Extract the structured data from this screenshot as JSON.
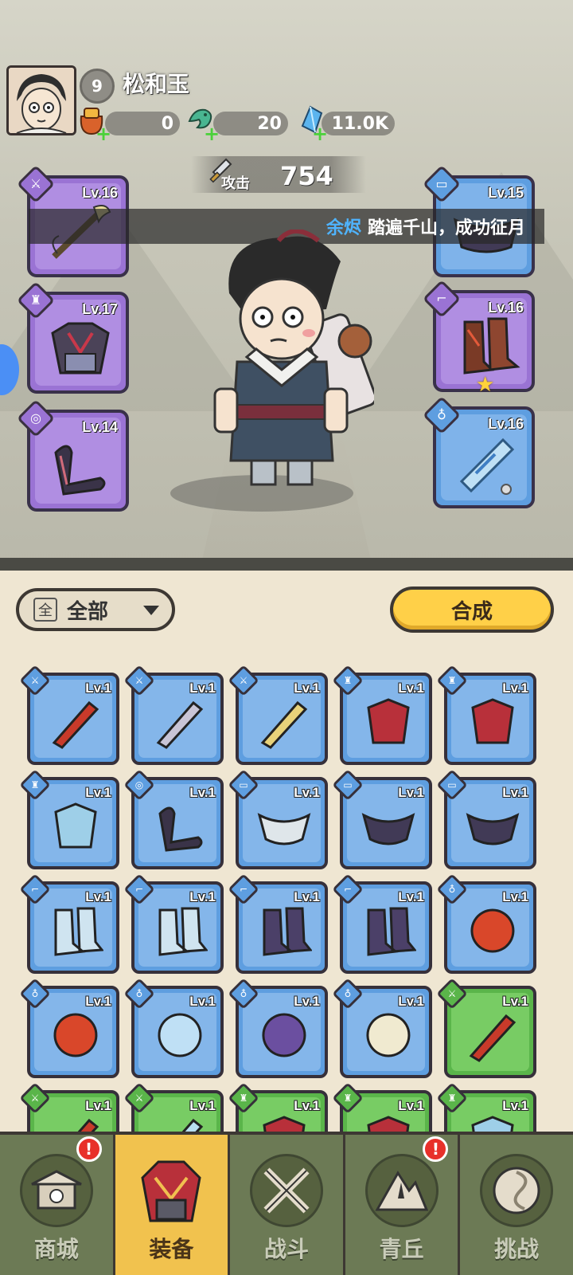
{
  "player": {
    "name": "松和玉",
    "level": "9"
  },
  "resources": [
    {
      "icon": "treasure-bag-icon",
      "value": "0"
    },
    {
      "icon": "jade-dragon-icon",
      "value": "20"
    },
    {
      "icon": "crystal-icon",
      "value": "11.0K"
    }
  ],
  "attack": {
    "label": "攻击",
    "value": "754"
  },
  "ticker": {
    "player": "余烬",
    "message": "踏遍千山，成功征月"
  },
  "equipped": [
    {
      "slot": "weapon",
      "level": "Lv.16",
      "rarity": "purple",
      "icon": "sword-icon",
      "side": "left",
      "item": "whip-sword-icon"
    },
    {
      "slot": "armor",
      "level": "Lv.17",
      "rarity": "purple",
      "icon": "armor-icon",
      "side": "left",
      "item": "dark-armor-icon"
    },
    {
      "slot": "bracer",
      "level": "Lv.14",
      "rarity": "purple",
      "icon": "bracer-icon",
      "side": "left",
      "item": "bracer-item-icon"
    },
    {
      "slot": "belt",
      "level": "Lv.15",
      "rarity": "blue",
      "icon": "belt-icon",
      "side": "right",
      "item": "belt-item-icon"
    },
    {
      "slot": "boots",
      "level": "Lv.16",
      "rarity": "purple",
      "icon": "boots-icon",
      "side": "right",
      "item": "boots-item-icon",
      "star": true
    },
    {
      "slot": "accessory",
      "level": "Lv.16",
      "rarity": "blue",
      "icon": "pendant-icon",
      "side": "right",
      "item": "jade-pendant-icon"
    }
  ],
  "inventory": {
    "filter_box": "全",
    "filter_label": "全部",
    "merge_label": "合成",
    "items": [
      {
        "level": "Lv.1",
        "rarity": "blue",
        "type": "weapon",
        "item": "red-flower-whip-icon"
      },
      {
        "level": "Lv.1",
        "rarity": "blue",
        "type": "weapon",
        "item": "hammer-icon"
      },
      {
        "level": "Lv.1",
        "rarity": "blue",
        "type": "weapon",
        "item": "golden-sword-icon"
      },
      {
        "level": "Lv.1",
        "rarity": "blue",
        "type": "armor",
        "item": "red-armor-icon"
      },
      {
        "level": "Lv.1",
        "rarity": "blue",
        "type": "armor",
        "item": "red-armor-icon"
      },
      {
        "level": "Lv.1",
        "rarity": "blue",
        "type": "armor",
        "item": "ice-armor-icon"
      },
      {
        "level": "Lv.1",
        "rarity": "blue",
        "type": "bracer",
        "item": "bracer-item-icon"
      },
      {
        "level": "Lv.1",
        "rarity": "blue",
        "type": "belt",
        "item": "fur-belt-icon"
      },
      {
        "level": "Lv.1",
        "rarity": "blue",
        "type": "belt",
        "item": "dark-belt-icon"
      },
      {
        "level": "Lv.1",
        "rarity": "blue",
        "type": "belt",
        "item": "dark-belt-icon"
      },
      {
        "level": "Lv.1",
        "rarity": "blue",
        "type": "boots",
        "item": "ice-boots-icon"
      },
      {
        "level": "Lv.1",
        "rarity": "blue",
        "type": "boots",
        "item": "ice-boots-icon"
      },
      {
        "level": "Lv.1",
        "rarity": "blue",
        "type": "boots",
        "item": "purple-boots-icon"
      },
      {
        "level": "Lv.1",
        "rarity": "blue",
        "type": "boots",
        "item": "purple-boots-icon"
      },
      {
        "level": "Lv.1",
        "rarity": "blue",
        "type": "accessory",
        "item": "fire-orb-icon"
      },
      {
        "level": "Lv.1",
        "rarity": "blue",
        "type": "accessory",
        "item": "fire-orb-icon"
      },
      {
        "level": "Lv.1",
        "rarity": "blue",
        "type": "accessory",
        "item": "jade-pendant-icon"
      },
      {
        "level": "Lv.1",
        "rarity": "blue",
        "type": "accessory",
        "item": "purple-amulet-icon"
      },
      {
        "level": "Lv.1",
        "rarity": "blue",
        "type": "accessory",
        "item": "fang-necklace-icon"
      },
      {
        "level": "Lv.1",
        "rarity": "green",
        "type": "weapon",
        "item": "red-flower-whip-icon"
      },
      {
        "level": "Lv.1",
        "rarity": "green",
        "type": "weapon",
        "item": "red-flower-whip-icon"
      },
      {
        "level": "Lv.1",
        "rarity": "green",
        "type": "weapon",
        "item": "ice-bow-icon"
      },
      {
        "level": "Lv.1",
        "rarity": "green",
        "type": "armor",
        "item": "red-armor-icon"
      },
      {
        "level": "Lv.1",
        "rarity": "green",
        "type": "armor",
        "item": "red-armor-icon"
      },
      {
        "level": "Lv.1",
        "rarity": "green",
        "type": "armor",
        "item": "ice-armor-icon"
      }
    ]
  },
  "nav": [
    {
      "label": "商城",
      "icon": "shop-icon",
      "active": false,
      "alert": "!"
    },
    {
      "label": "装备",
      "icon": "equipment-icon",
      "active": true,
      "alert": ""
    },
    {
      "label": "战斗",
      "icon": "crossed-swords-icon",
      "active": false,
      "alert": ""
    },
    {
      "label": "青丘",
      "icon": "mountain-icon",
      "active": false,
      "alert": "!"
    },
    {
      "label": "挑战",
      "icon": "challenge-icon",
      "active": false,
      "alert": ""
    }
  ],
  "colors": {
    "purple": "#9a73d4",
    "blue": "#5e9ee0",
    "green": "#5ab54a",
    "accent": "#ffd048",
    "nav": "#6c7a55"
  }
}
